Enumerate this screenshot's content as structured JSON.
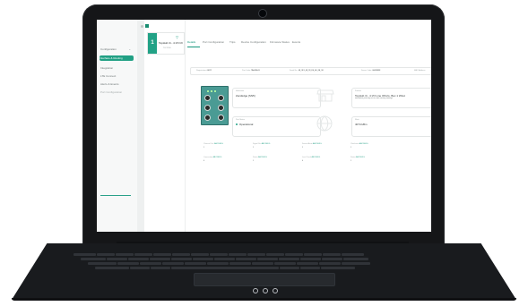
{
  "sidebar": {
    "items": [
      {
        "label": "Configuration",
        "active": false
      },
      {
        "label": "Interface & Routing",
        "active": true
      },
      {
        "label": "Integration",
        "active": false
      },
      {
        "label": "LTE Connect",
        "active": false
      },
      {
        "label": "Alerts & Events",
        "active": false
      },
      {
        "label": "Port Configuration",
        "active": false
      }
    ]
  },
  "device_card": {
    "badge": "1",
    "name": "TopHub 3i - 4 I/O I/OS...",
    "model": "TLY-1200"
  },
  "tabs": [
    "Details",
    "Port Configuration",
    "Trips",
    "Device Configuration",
    "Firmware Status",
    "Events"
  ],
  "info_bar": [
    {
      "label": "Registration:",
      "value": "06/22"
    },
    {
      "label": "Port Code:",
      "value": "TA0486-05"
    },
    {
      "label": "Serial No.:",
      "value": "48_3F1_48_28_FE_4E_FE_98"
    },
    {
      "label": "Server Code:",
      "value": "00089898"
    },
    {
      "label": "MAC Address:",
      "value": ""
    }
  ],
  "cards": {
    "hostname": {
      "label": "Hostname",
      "value": "ZeroEdge [SN5]"
    },
    "product": {
      "label": "Product",
      "name": "TopHub 3i - 4 I/O Line I/Ports, Box 1 Wireless (When",
      "description": "Monitored [FB/GW] Bi-Oil, with Factory settings"
    },
    "status": {
      "label": "Port Status",
      "value": "Operational"
    },
    "memory": {
      "label": "Slots",
      "value": "4074 kBm"
    }
  },
  "stats": [
    {
      "label": "Channel Cnt.",
      "link": "ABCDEFG",
      "value": "1"
    },
    {
      "label": "Signal Str.",
      "link": "ABCDEFG",
      "value": "1"
    },
    {
      "label": "Server Alarm",
      "link": "ABCDEFG",
      "value": "1"
    },
    {
      "label": "Checksum",
      "link": "ABCDEFG",
      "value": "1"
    },
    {
      "label": "Connection",
      "link": "ABCDEFG",
      "value": "0"
    },
    {
      "label": "Status",
      "link": "ABCDEFG",
      "value": "1"
    },
    {
      "label": "Last Check",
      "link": "ABCDEFG",
      "value": "0"
    },
    {
      "label": "Status",
      "link": "ABCDEFG",
      "value": "1"
    }
  ],
  "colors": {
    "accent": "#21a286",
    "device_panel": "#4a9b94",
    "laptop_body": "#151618"
  },
  "icons": {
    "filter": "filter-icon",
    "store": "store-icon",
    "globe": "globe-icon",
    "grid": "grid-icon"
  }
}
